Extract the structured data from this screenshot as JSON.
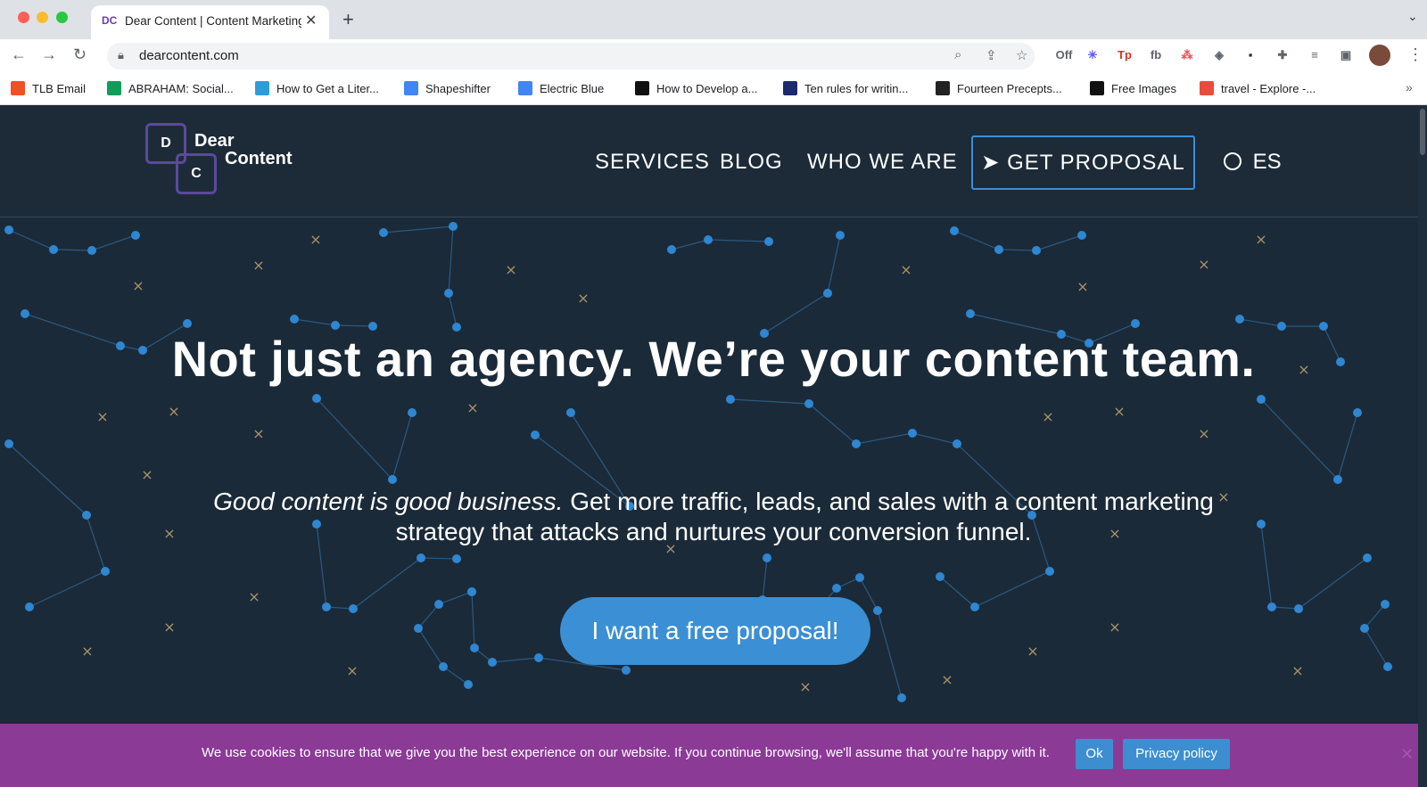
{
  "browser": {
    "tab_title": "Dear Content | Content Marketing Agency",
    "tab_favicon": "DC",
    "url": "dearcontent.com",
    "extensions": [
      "Off",
      "✳",
      "Tp",
      "fb",
      "⁂",
      "◈",
      "▪",
      "✚",
      "≡",
      "▣"
    ],
    "bookmarks": [
      {
        "label": "TLB Email",
        "color": "#f25022"
      },
      {
        "label": "ABRAHAM: Social...",
        "color": "#0f9d58"
      },
      {
        "label": "How to Get a Liter...",
        "color": "#2d9cdb"
      },
      {
        "label": "Shapeshifter",
        "color": "#4285f4"
      },
      {
        "label": "Electric Blue",
        "color": "#4285f4"
      },
      {
        "label": "How to Develop a...",
        "color": "#111111"
      },
      {
        "label": "Ten rules for writin...",
        "color": "#1a2a6c"
      },
      {
        "label": "Fourteen Precepts...",
        "color": "#222222"
      },
      {
        "label": "Free Images",
        "color": "#111111"
      },
      {
        "label": "travel - Explore -...",
        "color": "#e94b3c"
      }
    ],
    "bookmarks_more": "»"
  },
  "site": {
    "logo": {
      "letter_d": "D",
      "letter_c": "C",
      "word1": "Dear",
      "word2": "Content"
    },
    "nav": [
      "SERVICES",
      "BLOG",
      "WHO WE ARE"
    ],
    "proposal_button": "GET PROPOSAL",
    "language": "ES"
  },
  "hero": {
    "title": "Not just an agency. We’re your content team.",
    "subtitle_italic": "Good content is good business.",
    "subtitle_rest": " Get more traffic, leads, and sales with a content marketing strategy that attacks and nurtures your conversion funnel.",
    "cta": "I want a free proposal!"
  },
  "cookie": {
    "text": "We use cookies to ensure that we give you the best experience on our website. If you continue browsing, we'll assume that you're happy with it.",
    "ok": "Ok",
    "privacy": "Privacy policy"
  },
  "colors": {
    "page_bg": "#1b2a38",
    "accent_blue": "#3b8fd4",
    "cookie_bar": "#8b3a96",
    "constellation_dot": "#2f86d1",
    "cross_mark": "#a9936a"
  }
}
